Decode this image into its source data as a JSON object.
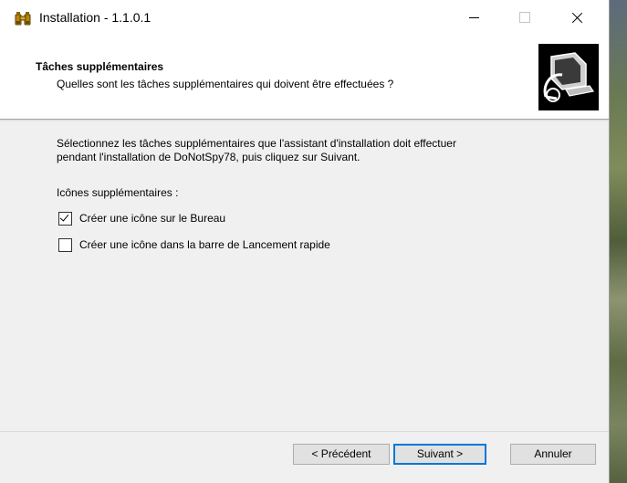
{
  "window": {
    "title": "Installation - 1.1.0.1"
  },
  "header": {
    "title": "Tâches supplémentaires",
    "subtitle": "Quelles sont les tâches supplémentaires qui doivent être effectuées ?"
  },
  "body": {
    "description_line1": "Sélectionnez les tâches supplémentaires que l'assistant d'installation doit effectuer",
    "description_line2": "pendant l'installation de DoNotSpy78, puis cliquez sur Suivant.",
    "group_label": "Icônes supplémentaires :",
    "tasks": [
      {
        "label": "Créer une icône sur le Bureau",
        "checked": true
      },
      {
        "label": "Créer une icône dans la barre de Lancement rapide",
        "checked": false
      }
    ]
  },
  "buttons": {
    "back": "< Précédent",
    "next": "Suivant >",
    "cancel": "Annuler"
  },
  "icons": {
    "app": "binoculars-icon",
    "wizard": "installer-computer-icon"
  },
  "colors": {
    "accent": "#0078d7",
    "dialog_bg": "#f0f0f0",
    "header_bg": "#ffffff"
  }
}
